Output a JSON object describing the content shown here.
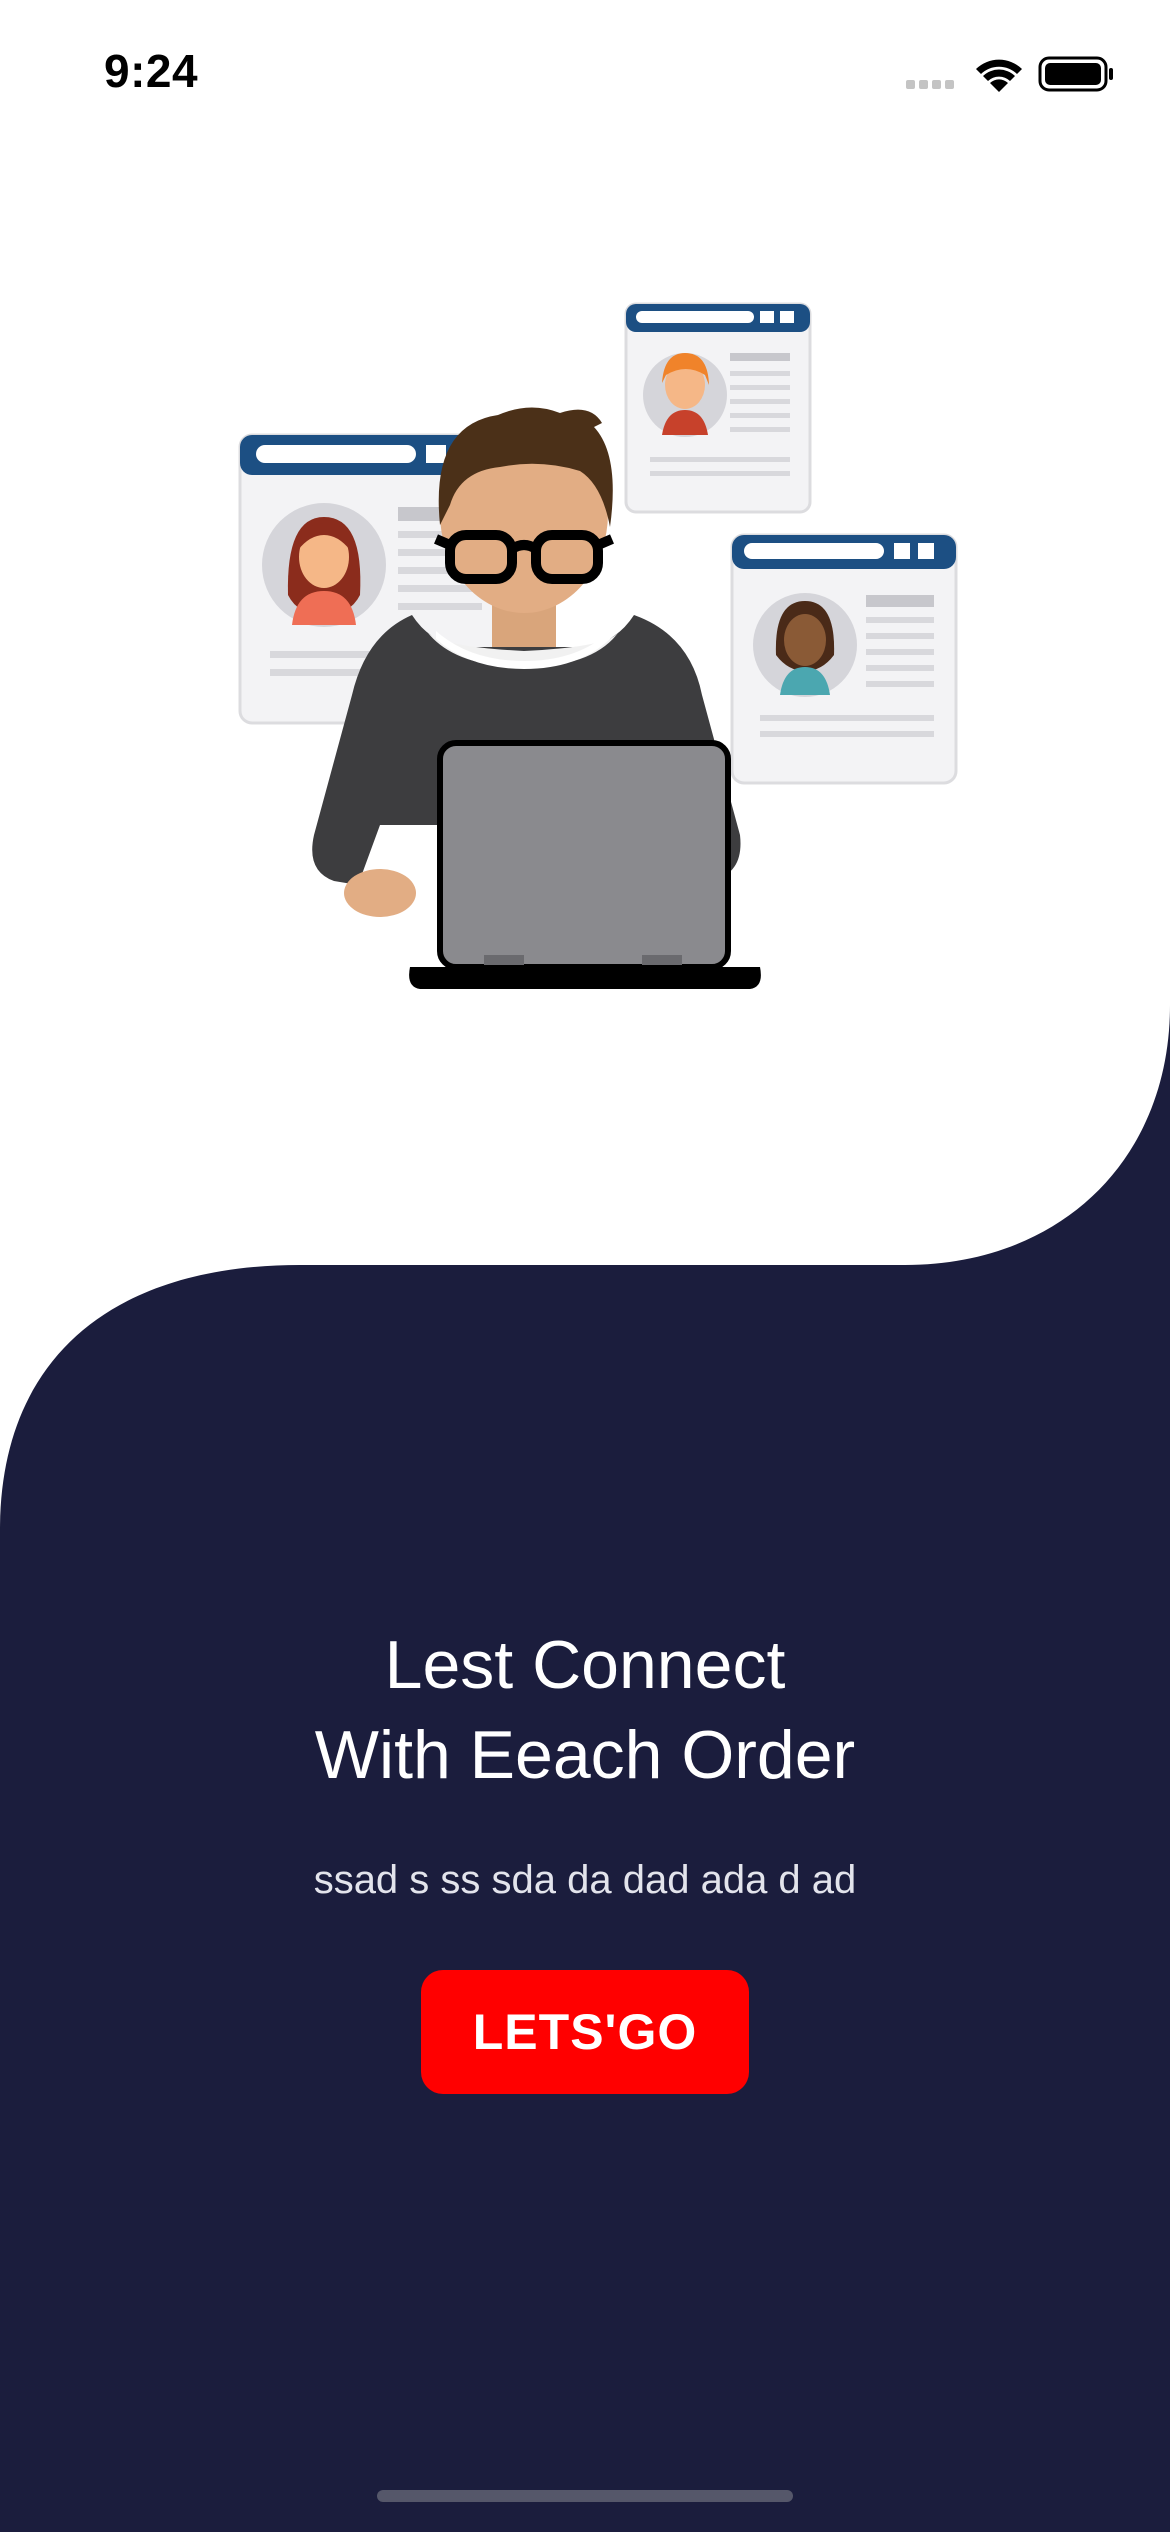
{
  "status_bar": {
    "time": "9:24",
    "icons": [
      "signal-icon",
      "wifi-icon",
      "battery-icon"
    ]
  },
  "illustration": {
    "icon": "person-with-laptop-illustration"
  },
  "content": {
    "headline_line1": "Lest Connect",
    "headline_line2": "With Eeach Order",
    "subtitle": "ssad s ss sda da dad ada d ad",
    "cta_label": "LETS'GO"
  },
  "colors": {
    "background_top": "#ffffff",
    "background_bottom": "#1b1d3d",
    "cta": "#ff0000",
    "text_on_dark": "#ffffff"
  }
}
